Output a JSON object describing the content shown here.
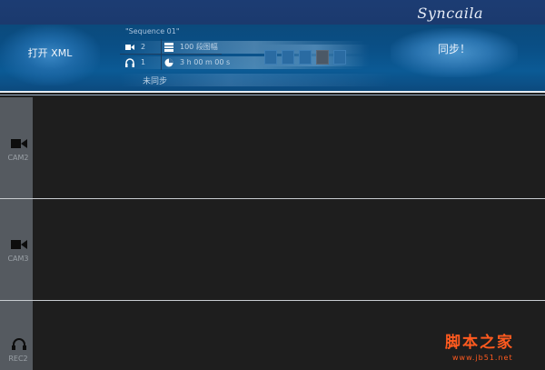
{
  "app": {
    "brand": "Syncaila"
  },
  "toolbar": {
    "open_xml_label": "打开 XML",
    "sync_label": "同步！",
    "sequence_name": "\"Sequence 01\"",
    "video_count": "2",
    "audio_count": "1",
    "frames_label": "100 段图幅",
    "duration_label": "3 h 00 m 00 s",
    "status_label": "未同步",
    "blocks": [
      {
        "state": "normal"
      },
      {
        "state": "normal"
      },
      {
        "state": "normal"
      },
      {
        "state": "active"
      },
      {
        "state": "normal"
      }
    ]
  },
  "tracks": [
    {
      "label": "CAM2",
      "icon": "video-camera-icon"
    },
    {
      "label": "CAM3",
      "icon": "video-camera-icon"
    },
    {
      "label": "REC2",
      "icon": "headphones-icon"
    }
  ],
  "watermark": {
    "text": "脚本之家",
    "url": "www.jb51.net"
  },
  "colors": {
    "titlebar": "#1c3c73",
    "toolbar": "#0b4a7c",
    "track_bg": "#1e1e1e",
    "track_side": "#555a60"
  }
}
